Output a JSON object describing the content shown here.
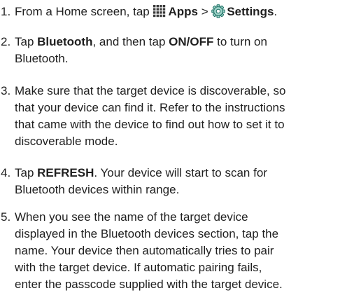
{
  "steps": [
    {
      "number": "1.",
      "lines": [
        {
          "t1": "From a Home screen, tap ",
          "icon1": "apps-grid-icon",
          "b1": "Apps",
          "t2": " > ",
          "icon2": "settings-gear-icon",
          "b2": "Settings",
          "t3": "."
        }
      ]
    },
    {
      "number": "2.",
      "lines": [
        {
          "t1": "Tap ",
          "b1": "Bluetooth",
          "t2": ", and then tap ",
          "b2": "ON/OFF",
          "t3": " to turn on"
        },
        {
          "t1": "Bluetooth."
        }
      ]
    },
    {
      "number": "3.",
      "lines": [
        {
          "t1": "Make sure that the target device is discoverable, so"
        },
        {
          "t1": "that your device can find it. Refer to the instructions"
        },
        {
          "t1": "that came with the device to find out how to set it to"
        },
        {
          "t1": "discoverable mode."
        }
      ]
    },
    {
      "number": "4.",
      "lines": [
        {
          "t1": "Tap ",
          "b1": "REFRESH",
          "t2": ". Your device will start to scan for"
        },
        {
          "t1": "Bluetooth devices within range."
        }
      ]
    },
    {
      "number": "5.",
      "lines": [
        {
          "t1": "When you see the name of the target device"
        },
        {
          "t1": "displayed in the Bluetooth devices section, tap the"
        },
        {
          "t1": "name. Your device then automatically tries to pair"
        },
        {
          "t1": "with the target device. If automatic pairing fails,"
        },
        {
          "t1": "enter the passcode supplied with the target device."
        }
      ]
    }
  ],
  "colors": {
    "text": "#1f1f1f",
    "apps_icon": "#3a3a3a",
    "settings_icon_fill": "#9fd3c9",
    "settings_icon_stroke": "#1b6f63"
  }
}
